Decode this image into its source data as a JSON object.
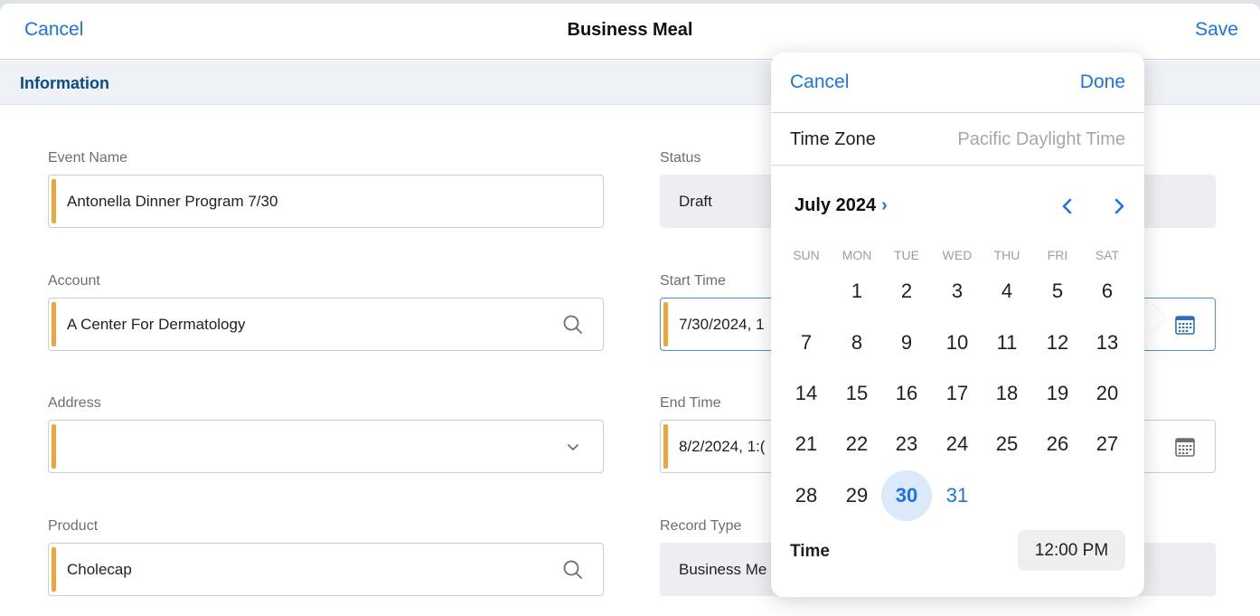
{
  "nav": {
    "cancel": "Cancel",
    "title": "Business Meal",
    "save": "Save"
  },
  "section": {
    "title": "Information"
  },
  "fields": {
    "event_name": {
      "label": "Event Name",
      "value": "Antonella Dinner Program 7/30"
    },
    "account": {
      "label": "Account",
      "value": "A Center For Dermatology",
      "icon": "search-icon"
    },
    "address": {
      "label": "Address",
      "value": "",
      "icon": "chevron-down-icon"
    },
    "product": {
      "label": "Product",
      "value": "Cholecap",
      "icon": "search-icon"
    },
    "status": {
      "label": "Status",
      "value": "Draft"
    },
    "start_time": {
      "label": "Start Time",
      "value": "7/30/2024, 1",
      "icon": "calendar-icon"
    },
    "end_time": {
      "label": "End Time",
      "value": "8/2/2024, 1:(",
      "icon": "calendar-icon"
    },
    "record_type": {
      "label": "Record Type",
      "value": "Business Me"
    }
  },
  "picker": {
    "cancel": "Cancel",
    "done": "Done",
    "time_zone_label": "Time Zone",
    "time_zone_value": "Pacific Daylight Time",
    "month_title": "July 2024",
    "month_chevron": "›",
    "weekdays": [
      "SUN",
      "MON",
      "TUE",
      "WED",
      "THU",
      "FRI",
      "SAT"
    ],
    "first_weekday_index": 1,
    "days": [
      "1",
      "2",
      "3",
      "4",
      "5",
      "6",
      "7",
      "8",
      "9",
      "10",
      "11",
      "12",
      "13",
      "14",
      "15",
      "16",
      "17",
      "18",
      "19",
      "20",
      "21",
      "22",
      "23",
      "24",
      "25",
      "26",
      "27",
      "28",
      "29",
      "30",
      "31"
    ],
    "selected_day": "30",
    "today_day": "31",
    "time_label": "Time",
    "time_value": "12:00 PM"
  },
  "colors": {
    "accent": "#1a73e8",
    "required_bar": "#f0a53a",
    "section_title": "#0b4a8b",
    "selected_bg": "#dbe9fb"
  }
}
